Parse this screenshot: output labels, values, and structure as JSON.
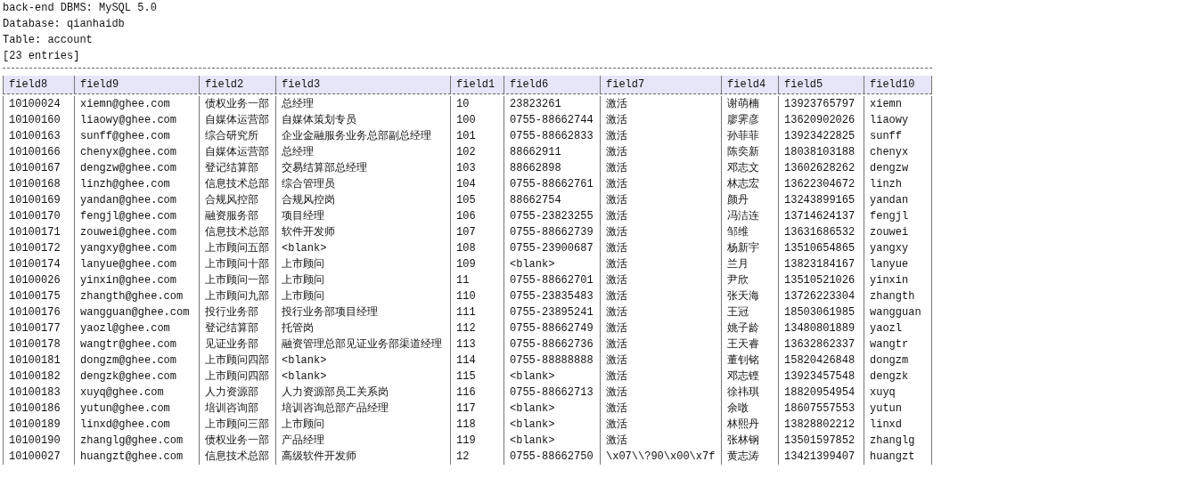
{
  "info_lines": [
    "back-end DBMS: MySQL 5.0",
    "Database: qianhaidb",
    "Table: account",
    "[23 entries]"
  ],
  "table": {
    "columns": [
      "field8",
      "field9",
      "field2",
      "field3",
      "field1",
      "field6",
      "field7",
      "field4",
      "field5",
      "field10"
    ],
    "rows": [
      [
        "10100024",
        "xiemn@ghee.com",
        "债权业务一部",
        "总经理",
        "10",
        "23823261",
        "激活",
        "谢萌楠",
        "13923765797",
        "xiemn"
      ],
      [
        "10100160",
        "liaowy@ghee.com",
        "自媒体运营部",
        "自媒体策划专员",
        "100",
        "0755-88662744",
        "激活",
        "廖霁彦",
        "13620902026",
        "liaowy"
      ],
      [
        "10100163",
        "sunff@ghee.com",
        "综合研究所",
        "企业金融服务业务总部副总经理",
        "101",
        "0755-88662833",
        "激活",
        "孙菲菲",
        "13923422825",
        "sunff"
      ],
      [
        "10100166",
        "chenyx@ghee.com",
        "自媒体运营部",
        "总经理",
        "102",
        "88662911",
        "激活",
        "陈奕新",
        "18038103188",
        "chenyx"
      ],
      [
        "10100167",
        "dengzw@ghee.com",
        "登记结算部",
        "交易结算部总经理",
        "103",
        "88662898",
        "激活",
        "邓志文",
        "13602628262",
        "dengzw"
      ],
      [
        "10100168",
        "linzh@ghee.com",
        "信息技术总部",
        "综合管理员",
        "104",
        "0755-88662761",
        "激活",
        "林志宏",
        "13622304672",
        "linzh"
      ],
      [
        "10100169",
        "yandan@ghee.com",
        "合规风控部",
        "合规风控岗",
        "105",
        "88662754",
        "激活",
        "颜丹",
        "13243899165",
        "yandan"
      ],
      [
        "10100170",
        "fengjl@ghee.com",
        "融资服务部",
        "项目经理",
        "106",
        "0755-23823255",
        "激活",
        "冯洁连",
        "13714624137",
        "fengjl"
      ],
      [
        "10100171",
        "zouwei@ghee.com",
        "信息技术总部",
        "软件开发师",
        "107",
        "0755-88662739",
        "激活",
        "邹维",
        "13631686532",
        "zouwei"
      ],
      [
        "10100172",
        "yangxy@ghee.com",
        "上市顾问五部",
        "<blank>",
        "108",
        "0755-23900687",
        "激活",
        "杨新宇",
        "13510654865",
        "yangxy"
      ],
      [
        "10100174",
        "lanyue@ghee.com",
        "上市顾问十部",
        "上市顾问",
        "109",
        "<blank>",
        "激活",
        "兰月",
        "13823184167",
        "lanyue"
      ],
      [
        "10100026",
        "yinxin@ghee.com",
        "上市顾问一部",
        "上市顾问",
        "11",
        "0755-88662701",
        "激活",
        "尹欣",
        "13510521026",
        "yinxin"
      ],
      [
        "10100175",
        "zhangth@ghee.com",
        "上市顾问九部",
        "上市顾问",
        "110",
        "0755-23835483",
        "激活",
        "张天海",
        "13726223304",
        "zhangth"
      ],
      [
        "10100176",
        "wangguan@ghee.com",
        "投行业务部",
        "投行业务部项目经理",
        "111",
        "0755-23895241",
        "激活",
        "王冠",
        "18503061985",
        "wangguan"
      ],
      [
        "10100177",
        "yaozl@ghee.com",
        "登记结算部",
        "托管岗",
        "112",
        "0755-88662749",
        "激活",
        "姚子龄",
        "13480801889",
        "yaozl"
      ],
      [
        "10100178",
        "wangtr@ghee.com",
        "见证业务部",
        "融资管理总部见证业务部渠道经理",
        "113",
        "0755-88662736",
        "激活",
        "王天睿",
        "13632862337",
        "wangtr"
      ],
      [
        "10100181",
        "dongzm@ghee.com",
        "上市顾问四部",
        "<blank>",
        "114",
        "0755-88888888",
        "激活",
        "董钊铭",
        "15820426848",
        "dongzm"
      ],
      [
        "10100182",
        "dengzk@ghee.com",
        "上市顾问四部",
        "<blank>",
        "115",
        "<blank>",
        "激活",
        "邓志铿",
        "13923457548",
        "dengzk"
      ],
      [
        "10100183",
        "xuyq@ghee.com",
        "人力资源部",
        "人力资源部员工关系岗",
        "116",
        "0755-88662713",
        "激活",
        "徐祎琪",
        "18820954954",
        "xuyq"
      ],
      [
        "10100186",
        "yutun@ghee.com",
        "培训咨询部",
        "培训咨询总部产品经理",
        "117",
        "<blank>",
        "激活",
        "余暾",
        "18607557553",
        "yutun"
      ],
      [
        "10100189",
        "linxd@ghee.com",
        "上市顾问三部",
        "上市顾问",
        "118",
        "<blank>",
        "激活",
        "林熙丹",
        "13828802212",
        "linxd"
      ],
      [
        "10100190",
        "zhanglg@ghee.com",
        "债权业务一部",
        "产品经理",
        "119",
        "<blank>",
        "激活",
        "张林钢",
        "13501597852",
        "zhanglg"
      ],
      [
        "10100027",
        "huangzt@ghee.com",
        "信息技术总部",
        "高级软件开发师",
        "12",
        "0755-88662750",
        "\\x07\\\\?90\\x00\\x7f",
        "黄志涛",
        "13421399407",
        "huangzt"
      ]
    ]
  }
}
